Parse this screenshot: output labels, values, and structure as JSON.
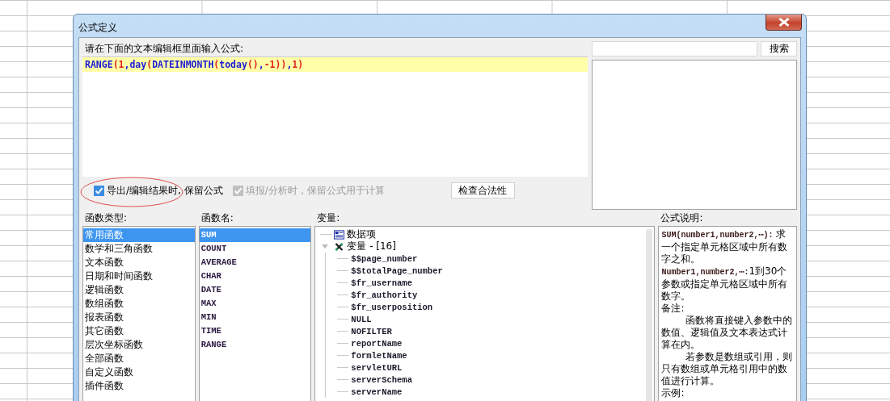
{
  "window": {
    "title": "公式定义"
  },
  "editor": {
    "label": "请在下面的文本编辑框里面输入公式:",
    "tokens": [
      {
        "text": "RANGE",
        "kind": "function"
      },
      {
        "text": "(",
        "kind": "paren"
      },
      {
        "text": "1",
        "kind": "number"
      },
      {
        "text": ",",
        "kind": "punct"
      },
      {
        "text": "day",
        "kind": "function"
      },
      {
        "text": "(",
        "kind": "paren"
      },
      {
        "text": "DATEINMONTH",
        "kind": "function"
      },
      {
        "text": "(",
        "kind": "paren"
      },
      {
        "text": "today",
        "kind": "function"
      },
      {
        "text": "()",
        "kind": "paren"
      },
      {
        "text": ",",
        "kind": "punct"
      },
      {
        "text": "-1",
        "kind": "number"
      },
      {
        "text": "))",
        "kind": "paren"
      },
      {
        "text": ",",
        "kind": "punct"
      },
      {
        "text": "1",
        "kind": "number"
      },
      {
        "text": ")",
        "kind": "paren"
      }
    ]
  },
  "search": {
    "button": "搜索"
  },
  "options": [
    {
      "label": "导出/编辑结果时, 保留公式",
      "checked": true,
      "disabled": false
    },
    {
      "label": "填报/分析时，保留公式用于计算",
      "checked": true,
      "disabled": true
    }
  ],
  "check_button": "检查合法性",
  "function_types": {
    "label": "函数类型:",
    "items": [
      {
        "label": "常用函数",
        "selected": true
      },
      {
        "label": "数学和三角函数",
        "selected": false
      },
      {
        "label": "文本函数",
        "selected": false
      },
      {
        "label": "日期和时间函数",
        "selected": false
      },
      {
        "label": "逻辑函数",
        "selected": false
      },
      {
        "label": "数组函数",
        "selected": false
      },
      {
        "label": "报表函数",
        "selected": false
      },
      {
        "label": "其它函数",
        "selected": false
      },
      {
        "label": "层次坐标函数",
        "selected": false
      },
      {
        "label": "全部函数",
        "selected": false
      },
      {
        "label": "自定义函数",
        "selected": false
      },
      {
        "label": "插件函数",
        "selected": false
      }
    ]
  },
  "function_names": {
    "label": "函数名:",
    "items": [
      {
        "label": "SUM",
        "selected": true
      },
      {
        "label": "COUNT",
        "selected": false
      },
      {
        "label": "AVERAGE",
        "selected": false
      },
      {
        "label": "CHAR",
        "selected": false
      },
      {
        "label": "DATE",
        "selected": false
      },
      {
        "label": "MAX",
        "selected": false
      },
      {
        "label": "MIN",
        "selected": false
      },
      {
        "label": "TIME",
        "selected": false
      },
      {
        "label": "RANGE",
        "selected": false
      }
    ]
  },
  "variables": {
    "label": "变量:",
    "tree": [
      {
        "label": "数据项",
        "kind": "dataset"
      },
      {
        "label": "变量 - [16]",
        "kind": "group",
        "expanded": true,
        "children": [
          {
            "label": "$$page_number"
          },
          {
            "label": "$$totalPage_number"
          },
          {
            "label": "$fr_username"
          },
          {
            "label": "$fr_authority"
          },
          {
            "label": "$fr_userposition"
          },
          {
            "label": "NULL"
          },
          {
            "label": "NOFILTER"
          },
          {
            "label": "reportName"
          },
          {
            "label": "formletName"
          },
          {
            "label": "servletURL"
          },
          {
            "label": "serverSchema"
          },
          {
            "label": "serverName"
          }
        ]
      }
    ]
  },
  "description": {
    "label": "公式说明:",
    "paragraphs": [
      {
        "code": "SUM(number1,number2,⋯):",
        "text": " 求一个指定单元格区域中所有数字之和。",
        "indent": false
      },
      {
        "code": "Number1,number2,⋯:",
        "text": "1到30个参数或指定单元格区域中所有数字。",
        "indent": false
      },
      {
        "text": "备注:",
        "indent": false
      },
      {
        "text": "函数将直接键入参数中的数值、逻辑值及文本表达式计算在内。",
        "indent": true
      },
      {
        "text": "若参数是数组或引用，则只有数组或单元格引用中的数值进行计算。",
        "indent": true
      },
      {
        "text": "示例:",
        "indent": false
      }
    ]
  }
}
